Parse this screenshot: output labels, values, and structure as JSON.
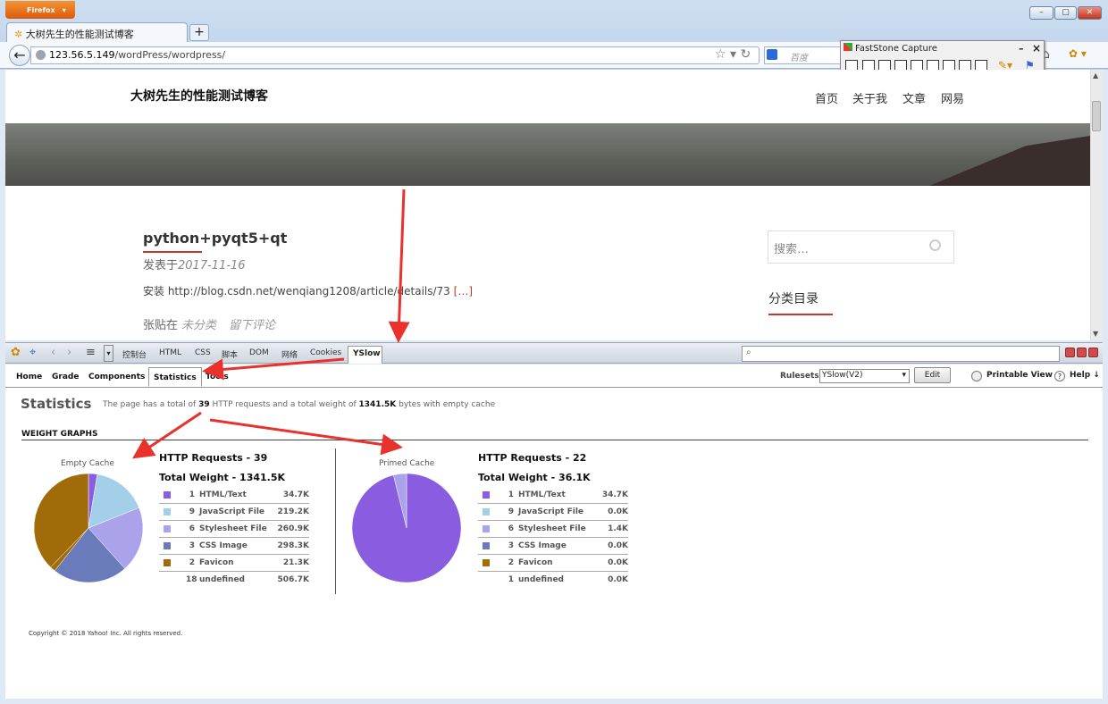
{
  "browser": {
    "menu_button": "Firefox",
    "tab_title": "大树先生的性能测试博客",
    "tab_close": "×",
    "new_tab": "+",
    "url_host": "123.56.5.149",
    "url_path": "/wordPress/wordpress/",
    "search_placeholder": "百度",
    "window_controls": [
      "–",
      "▢",
      "✕"
    ]
  },
  "faststone": {
    "title": "FastStone Capture",
    "controls": [
      "–",
      "×"
    ]
  },
  "blog": {
    "site_title": "大树先生的性能测试博客",
    "nav": [
      "首页",
      "关于我",
      "文章",
      "网易"
    ],
    "post_title": "python+pyqt5+qt",
    "post_meta_prefix": "发表于",
    "post_date": "2017-11-16",
    "post_excerpt": "安装 http://blog.csdn.net/wenqiang1208/article/details/73",
    "post_more": "[…]",
    "post_foot_prefix": "张贴在",
    "post_category": "未分类",
    "post_comment": "留下评论",
    "sidebar_search_placeholder": "搜索…",
    "sidebar_category_title": "分类目录"
  },
  "firebug": {
    "tabs": [
      "控制台",
      "HTML",
      "CSS",
      "脚本",
      "DOM",
      "网络",
      "Cookies"
    ],
    "active_tab": "YSlow"
  },
  "yslow": {
    "tabs": [
      "Home",
      "Grade",
      "Components",
      "Statistics",
      "Tools"
    ],
    "rulesets_label": "Rulesets",
    "rulesets_value": "YSlow(V2)",
    "edit_button": "Edit",
    "printable_view": "Printable View",
    "help": "Help ↓",
    "statistics_title": "Statistics",
    "summary_prefix": "The page has a total of",
    "summary_requests": "39",
    "summary_mid": "HTTP requests and a total weight of",
    "summary_weight": "1341.5K",
    "summary_suffix": "bytes with empty cache",
    "weight_graphs_label": "WEIGHT GRAPHS",
    "copyright": "Copyright © 2018 Yahoo! Inc. All rights reserved."
  },
  "chart_data": [
    {
      "type": "pie",
      "title": "Empty Cache",
      "header_requests": "HTTP Requests - 39",
      "header_weight": "Total Weight - 1341.5K",
      "rows": [
        {
          "count": "1",
          "name": "HTML/Text",
          "size": "34.7K",
          "color": "#8a5ce0"
        },
        {
          "count": "9",
          "name": "JavaScript File",
          "size": "219.2K",
          "color": "#a3d0e8"
        },
        {
          "count": "6",
          "name": "Stylesheet File",
          "size": "260.9K",
          "color": "#aaa2ea"
        },
        {
          "count": "3",
          "name": "CSS Image",
          "size": "298.3K",
          "color": "#6a7bbb"
        },
        {
          "count": "2",
          "name": "Favicon",
          "size": "21.3K",
          "color": "#a06b08"
        },
        {
          "count": "18",
          "name": "undefined",
          "size": "506.7K",
          "color": ""
        }
      ],
      "values": [
        34.7,
        219.2,
        260.9,
        298.3,
        21.3,
        506.7
      ],
      "slice_colors": [
        "#8a5ce0",
        "#a3d0e8",
        "#aaa2ea",
        "#6a7bbb",
        "#a06b08",
        "#a06b08"
      ]
    },
    {
      "type": "pie",
      "title": "Primed Cache",
      "header_requests": "HTTP Requests - 22",
      "header_weight": "Total Weight - 36.1K",
      "rows": [
        {
          "count": "1",
          "name": "HTML/Text",
          "size": "34.7K",
          "color": "#8a5ce0"
        },
        {
          "count": "9",
          "name": "JavaScript File",
          "size": "0.0K",
          "color": "#a3d0e8"
        },
        {
          "count": "6",
          "name": "Stylesheet File",
          "size": "1.4K",
          "color": "#aaa2ea"
        },
        {
          "count": "3",
          "name": "CSS Image",
          "size": "0.0K",
          "color": "#6a7bbb"
        },
        {
          "count": "2",
          "name": "Favicon",
          "size": "0.0K",
          "color": "#a06b08"
        },
        {
          "count": "1",
          "name": "undefined",
          "size": "0.0K",
          "color": ""
        }
      ],
      "values": [
        34.7,
        0.0,
        1.4,
        0.0,
        0.0,
        0.0
      ],
      "slice_colors": [
        "#8a5ce0",
        "#a3d0e8",
        "#aaa2ea",
        "#6a7bbb",
        "#a06b08",
        "#a06b08"
      ]
    }
  ]
}
